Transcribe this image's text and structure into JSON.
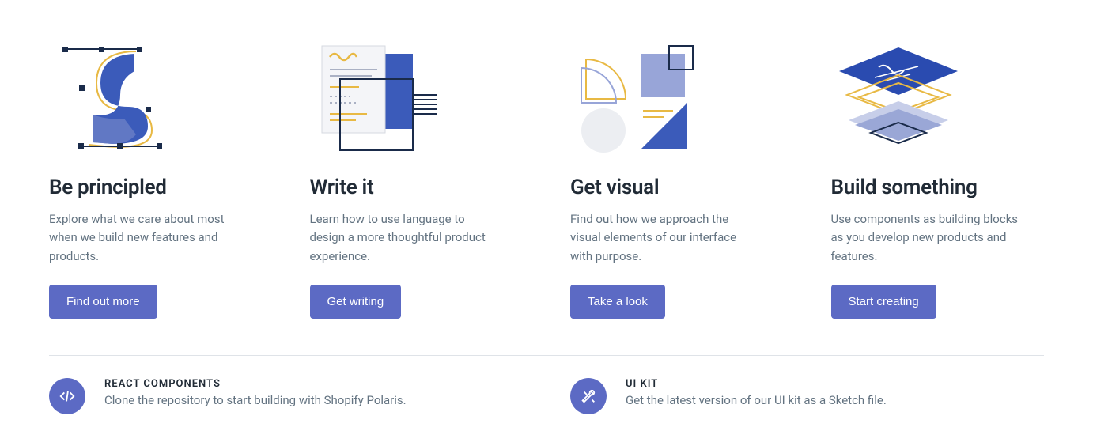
{
  "cards": [
    {
      "title": "Be principled",
      "desc": "Explore what we care about most when we build new features and products.",
      "cta": "Find out more"
    },
    {
      "title": "Write it",
      "desc": "Learn how to use language to design a more thoughtful product experience.",
      "cta": "Get writing"
    },
    {
      "title": "Get visual",
      "desc": "Find out how we approach the visual elements of our interface with purpose.",
      "cta": "Take a look"
    },
    {
      "title": "Build something",
      "desc": "Use components as building blocks as you develop new products and features.",
      "cta": "Start creating"
    }
  ],
  "resources": [
    {
      "label": "REACT COMPONENTS",
      "desc": "Clone the repository to start building with Shopify Polaris."
    },
    {
      "label": "UI KIT",
      "desc": "Get the latest version of our UI kit as a Sketch file."
    }
  ]
}
